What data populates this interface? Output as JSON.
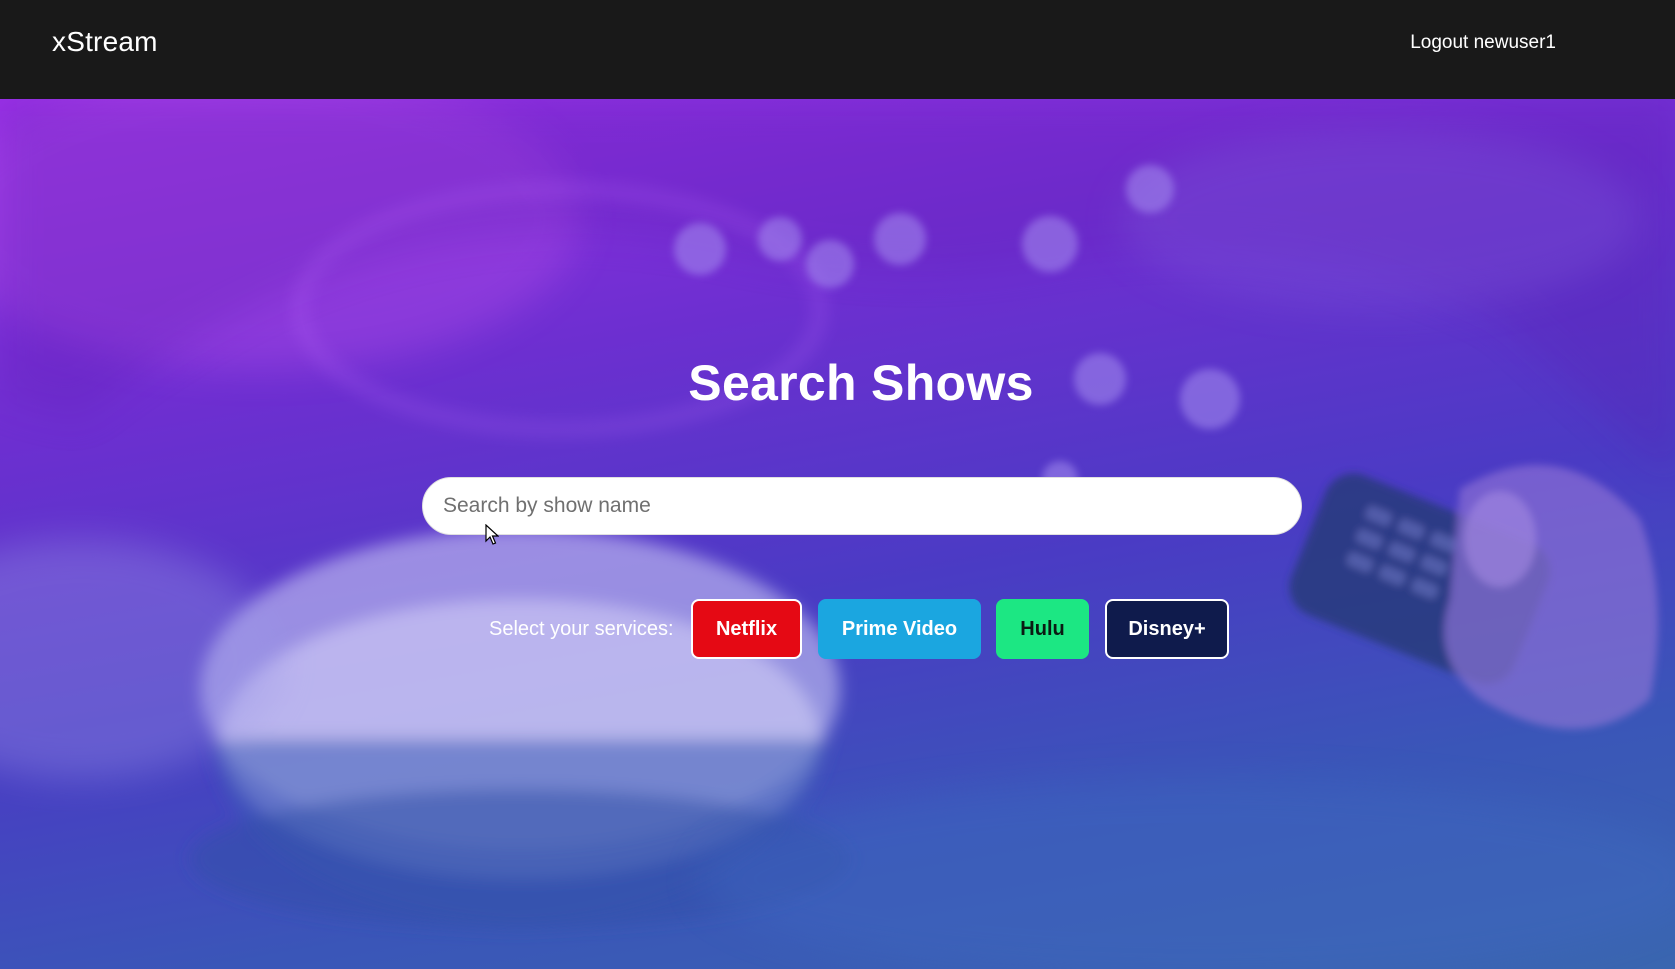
{
  "navbar": {
    "brand": "xStream",
    "logout_label": "Logout newuser1"
  },
  "hero": {
    "title": "Search Shows",
    "search": {
      "placeholder": "Search by show name",
      "value": ""
    },
    "services_label": "Select your services:",
    "services": [
      {
        "label": "Netflix",
        "color": "#e50914"
      },
      {
        "label": "Prime Video",
        "color": "#1ba6e0"
      },
      {
        "label": "Hulu",
        "color": "#1ce783"
      },
      {
        "label": "Disney+",
        "color": "#0f1b4c"
      }
    ]
  },
  "colors": {
    "navbar_bg": "#191919",
    "gradient_top": "#9a30e6",
    "gradient_bottom": "#3a66b0"
  }
}
